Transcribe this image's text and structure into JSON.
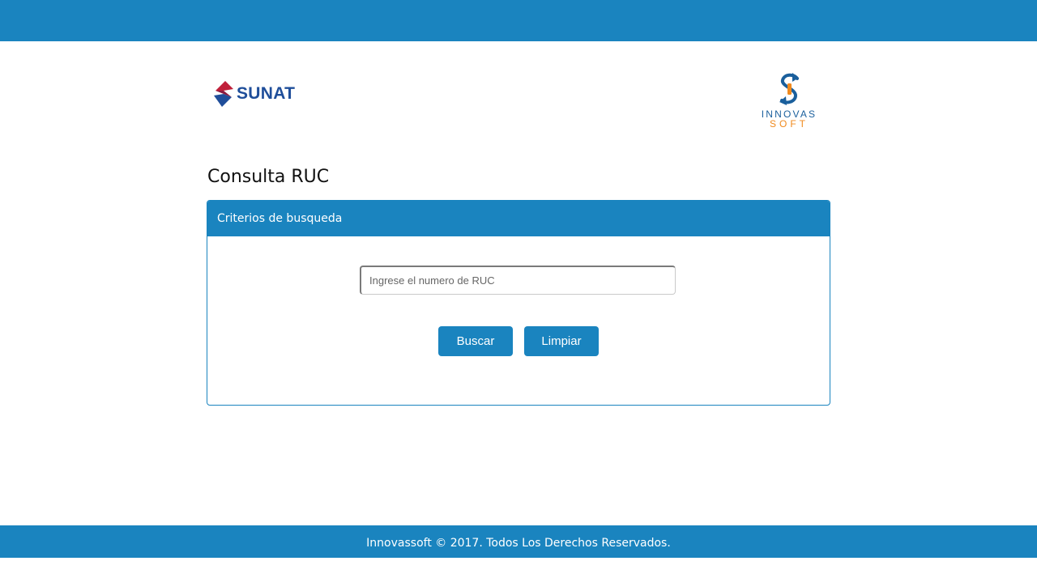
{
  "header": {
    "sunat_logo_text": "SUNAT",
    "innovas_logo_line1": "INNOVAS",
    "innovas_logo_line2": "SOFT"
  },
  "page": {
    "title": "Consulta RUC"
  },
  "panel": {
    "header": "Criterios de busqueda",
    "ruc_input": {
      "value": "",
      "placeholder": "Ingrese el numero de RUC"
    },
    "buttons": {
      "search_label": "Buscar",
      "clear_label": "Limpiar"
    }
  },
  "footer": {
    "text": "Innovassoft © 2017. Todos Los Derechos Reservados."
  },
  "colors": {
    "primary": "#1a84bf",
    "sunat_red": "#c0203a",
    "sunat_blue": "#1f4e9a",
    "innovas_blue": "#1a5f9c",
    "innovas_orange": "#f08a1e"
  },
  "icons": {
    "sunat_logo": "sunat-logo-icon",
    "innovas_logo": "innovas-logo-icon"
  }
}
